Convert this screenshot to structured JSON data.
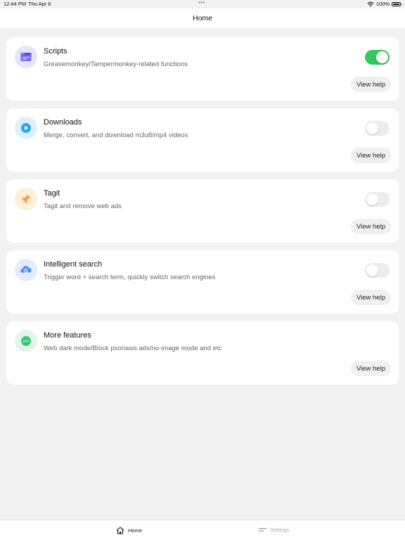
{
  "status_bar": {
    "time": "12:44 PM",
    "date": "Thu Apr 6",
    "dots": "•••",
    "battery": "100%"
  },
  "nav": {
    "title": "Home"
  },
  "cards": [
    {
      "title": "Scripts",
      "desc": "Greasemonkey/Tampermonkey-related functions",
      "help": "View help",
      "toggle": "on",
      "icon": "browser-window-icon",
      "icon_bg": "#e6e4fb",
      "icon_color": "#6c5ce7"
    },
    {
      "title": "Downloads",
      "desc": "Merge, convert, and download m3u8/mp4 videos",
      "help": "View help",
      "toggle": "off",
      "icon": "play-icon",
      "icon_bg": "#dff0fb",
      "icon_color": "#2aa7f0"
    },
    {
      "title": "Tagit",
      "desc": "Tagit and remove web ads",
      "help": "View help",
      "toggle": "off",
      "icon": "pin-icon",
      "icon_bg": "#fdefd8",
      "icon_color": "#f59a3e"
    },
    {
      "title": "Intelligent search",
      "desc": "Trigger word + search term, quickly switch search engines",
      "help": "View help",
      "toggle": "off",
      "icon": "cloud-search-icon",
      "icon_bg": "#e2ecfb",
      "icon_color": "#4c8cf5"
    },
    {
      "title": "More features",
      "desc": "Web dark mode/Block psoriasis ads/no-image mode and etc",
      "help": "View help",
      "toggle": null,
      "icon": "more-dots-icon",
      "icon_bg": "#e3f5ea",
      "icon_color": "#3dc97a"
    }
  ],
  "tabbar": {
    "home": "Home",
    "settings": "Settings"
  },
  "colors": {
    "toggle_on": "#34c759",
    "toggle_off": "#ececec",
    "background": "#f2f2f2"
  }
}
